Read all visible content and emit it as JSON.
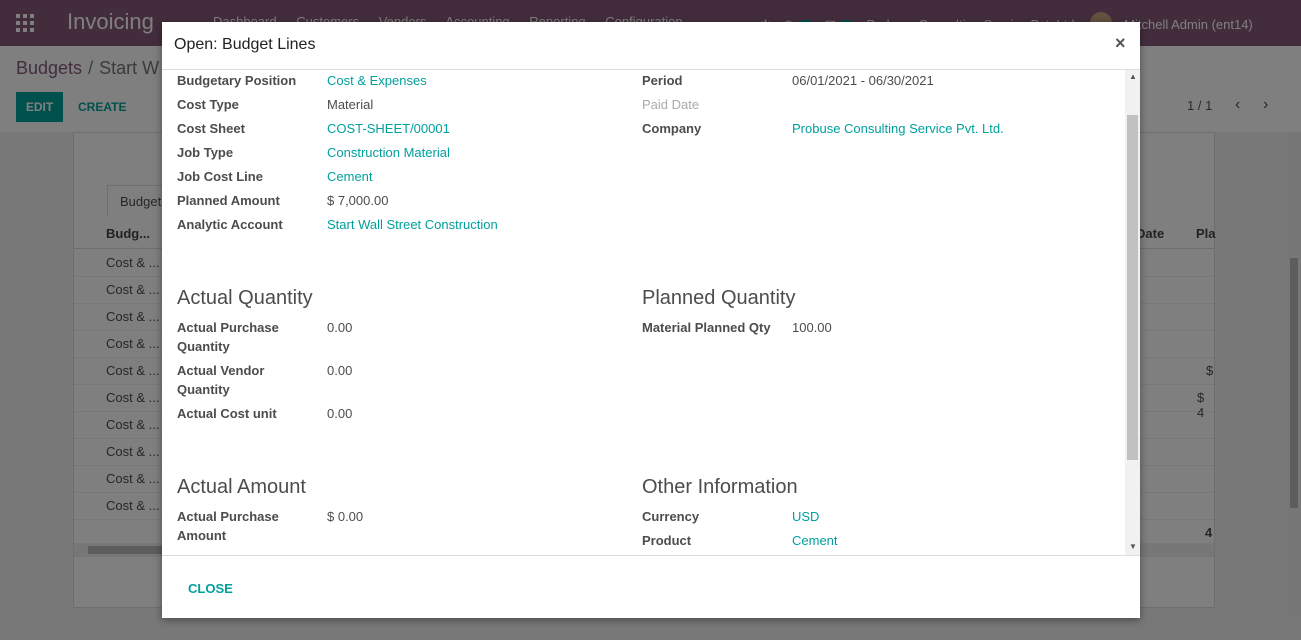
{
  "navbar": {
    "app_name": "Invoicing",
    "menu": [
      "Dashboard",
      "Customers",
      "Vendors",
      "Accounting",
      "Reporting",
      "Configuration"
    ],
    "activity_count": "5",
    "message_count": "5",
    "company": "Probuse Consulting Service Pvt. Ltd.",
    "user": "Mitchell Admin (ent14)"
  },
  "control_panel": {
    "breadcrumb_root": "Budgets",
    "breadcrumb_current": "Start W",
    "edit_label": "EDIT",
    "create_label": "CREATE",
    "pager": "1 / 1"
  },
  "background_list": {
    "tab_label": "Budget",
    "col_budget": "Budg...",
    "col_date": "Date",
    "col_planned": "Pla",
    "rows": [
      "Cost & ...",
      "Cost & ...",
      "Cost & ...",
      "Cost & ...",
      "Cost & ...",
      "Cost & ...",
      "Cost & ...",
      "Cost & ...",
      "Cost & ...",
      "Cost & ..."
    ],
    "cell_a": "$",
    "cell_b": "$ 4",
    "total": "4"
  },
  "modal": {
    "title": "Open: Budget Lines",
    "close_x": "×",
    "close_label": "CLOSE",
    "left_fields": [
      {
        "label": "Budgetary Position",
        "value": "Cost & Expenses"
      },
      {
        "label": "Cost Type",
        "value": "Material"
      },
      {
        "label": "Cost Sheet",
        "value": "COST-SHEET/00001"
      },
      {
        "label": "Job Type",
        "value": "Construction Material"
      },
      {
        "label": "Job Cost Line",
        "value": "Cement"
      },
      {
        "label": "Planned Amount",
        "value": "$ 7,000.00"
      },
      {
        "label": "Analytic Account",
        "value": "Start Wall Street Construction"
      }
    ],
    "right_fields": [
      {
        "label": "Period",
        "value": "06/01/2021 - 06/30/2021"
      },
      {
        "label": "Paid Date",
        "value": ""
      },
      {
        "label": "Company",
        "value": "Probuse Consulting Service Pvt. Ltd."
      }
    ],
    "actual_quantity": {
      "title": "Actual Quantity",
      "fields": [
        {
          "label": "Actual Purchase Quantity",
          "value": "0.00"
        },
        {
          "label": "Actual Vendor Quantity",
          "value": "0.00"
        },
        {
          "label": "Actual Cost unit",
          "value": "0.00"
        }
      ]
    },
    "planned_quantity": {
      "title": "Planned Quantity",
      "fields": [
        {
          "label": "Material Planned Qty",
          "value": "100.00"
        }
      ]
    },
    "actual_amount": {
      "title": "Actual Amount",
      "fields": [
        {
          "label": "Actual Purchase Amount",
          "value": "$ 0.00"
        }
      ]
    },
    "other_information": {
      "title": "Other Information",
      "fields": [
        {
          "label": "Currency",
          "value": "USD"
        },
        {
          "label": "Product",
          "value": "Cement"
        }
      ]
    }
  }
}
